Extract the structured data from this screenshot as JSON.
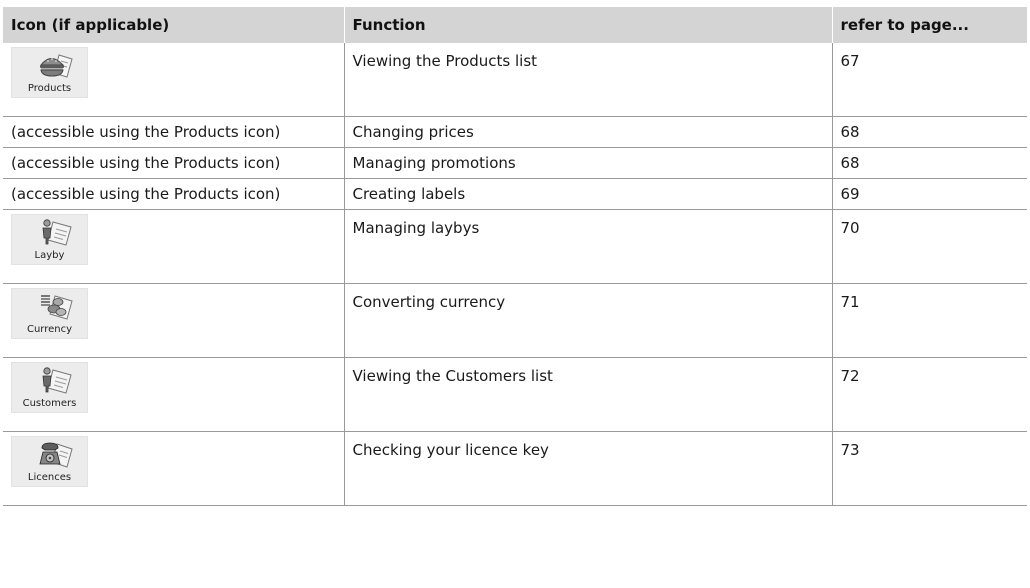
{
  "table": {
    "headers": {
      "icon": "Icon (if applicable)",
      "function": "Function",
      "page": "refer to page..."
    },
    "rows": [
      {
        "icon": "Products",
        "icon_name": "burger-icon",
        "function": "Viewing the Products list",
        "page": "67"
      },
      {
        "note": "(accessible using the Products icon)",
        "function": "Changing prices",
        "page": "68"
      },
      {
        "note": "(accessible using the Products icon)",
        "function": "Managing promotions",
        "page": "68"
      },
      {
        "note": "(accessible using the Products icon)",
        "function": "Creating labels",
        "page": "69"
      },
      {
        "icon": "Layby",
        "icon_name": "person-document-icon",
        "function": "Managing laybys",
        "page": "70"
      },
      {
        "icon": "Currency",
        "icon_name": "coins-icon",
        "function": "Converting currency",
        "page": "71"
      },
      {
        "icon": "Customers",
        "icon_name": "person-document-icon",
        "function": "Viewing the Customers list",
        "page": "72"
      },
      {
        "icon": "Licences",
        "icon_name": "telephone-icon",
        "function": "Checking your licence key",
        "page": "73"
      }
    ]
  },
  "colors": {
    "header_bg": "#d4d4d4",
    "grid_line": "#9a9a9a",
    "tile_bg": "#ececec"
  }
}
